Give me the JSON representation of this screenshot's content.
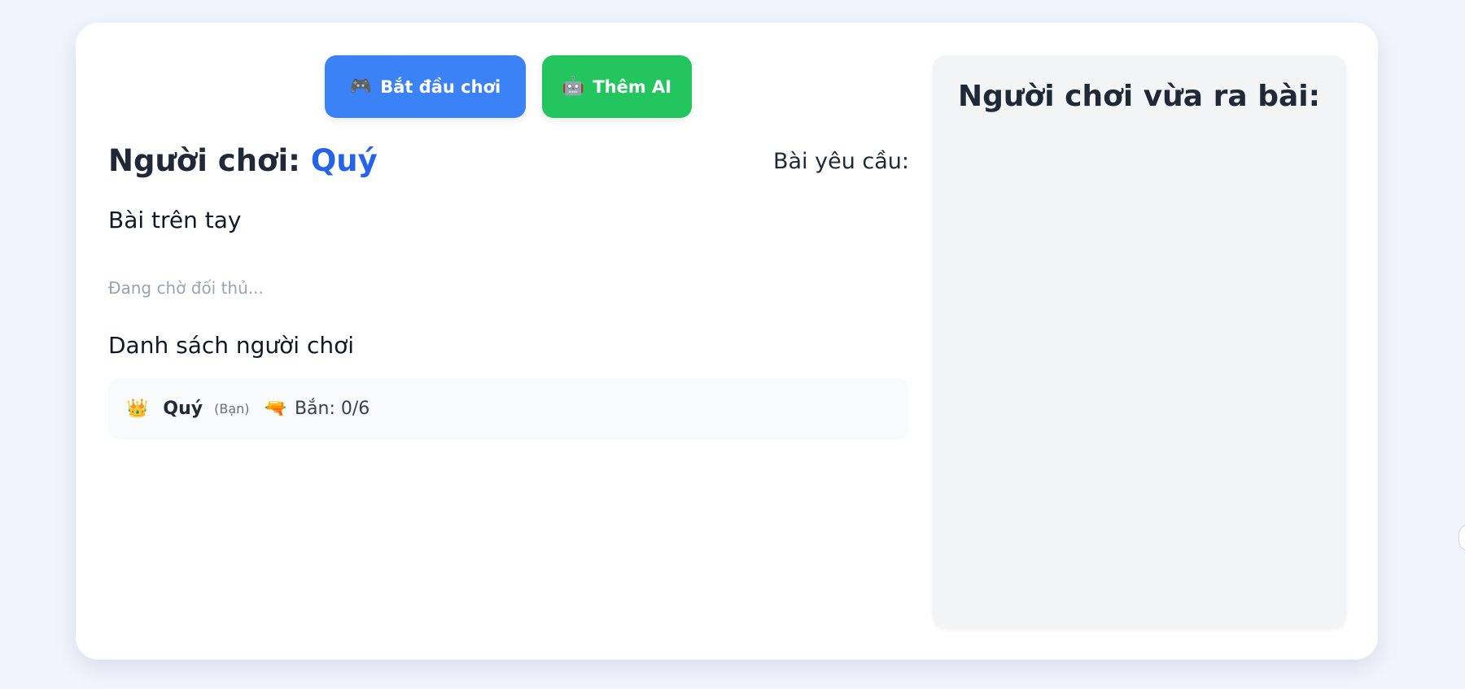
{
  "toolbar": {
    "start_icon": "🎮",
    "start_label": "Bắt đầu chơi",
    "add_ai_icon": "🤖",
    "add_ai_label": "Thêm AI"
  },
  "player": {
    "prefix": "Người chơi:",
    "name": "Quý"
  },
  "required_card_label": "Bài yêu cầu:",
  "hand": {
    "title": "Bài trên tay",
    "waiting_text": "Đang chờ đối thủ..."
  },
  "player_list": {
    "title": "Danh sách người chơi",
    "rows": [
      {
        "crown_icon": "👑",
        "name": "Quý",
        "you_tag": "(Bạn)",
        "gun_icon": "🔫",
        "shots_text": "Bắn: 0/6"
      }
    ]
  },
  "side_panel": {
    "title": "Người chơi vừa ra bài:"
  },
  "colors": {
    "background": "#f0f4fc",
    "start_button": "#3b82f6",
    "add_ai_button": "#22c55e",
    "player_name": "#2563eb",
    "side_panel": "#f3f4f6"
  }
}
